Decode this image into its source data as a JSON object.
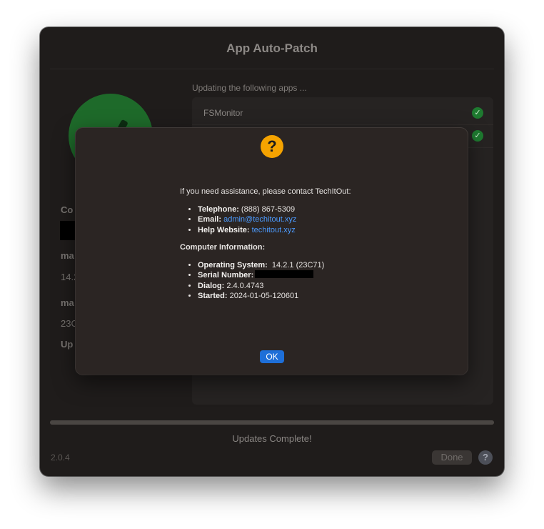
{
  "window": {
    "title": "App Auto-Patch",
    "sidebar_lines": [
      "Co",
      "ma",
      "14.2",
      "ma",
      "23C",
      "Up"
    ],
    "list_caption": "Updating the following apps ...",
    "apps": [
      {
        "name": "FSMonitor",
        "status": "complete"
      },
      {
        "name": "",
        "status": "complete"
      }
    ],
    "progress_percent": 100,
    "status_text": "Updates Complete!",
    "version": "2.0.4",
    "done_label": "Done",
    "help_label": "?"
  },
  "dialog": {
    "icon_symbol": "?",
    "intro": "If you need assistance, please contact TechItOut:",
    "contact": {
      "telephone_label": "Telephone:",
      "telephone_value": " (888) 867-5309",
      "email_label": "Email:",
      "email_value": "admin@techitout.xyz",
      "website_label": "Help Website:",
      "website_value": "techitout.xyz"
    },
    "computer_heading": "Computer Information:",
    "computer": {
      "os_label": "Operating System:",
      "os_value": "  14.2.1 (23C71)",
      "serial_label": "Serial Number:",
      "dialog_label": "Dialog:",
      "dialog_value": " 2.4.0.4743",
      "started_label": "Started:",
      "started_value": " 2024-01-05-120601"
    },
    "ok_label": "OK"
  },
  "colors": {
    "accent_blue": "#1e6fd8",
    "link_blue": "#4c9bff",
    "warning_orange": "#f5a300",
    "success_green": "#1e7a30"
  }
}
